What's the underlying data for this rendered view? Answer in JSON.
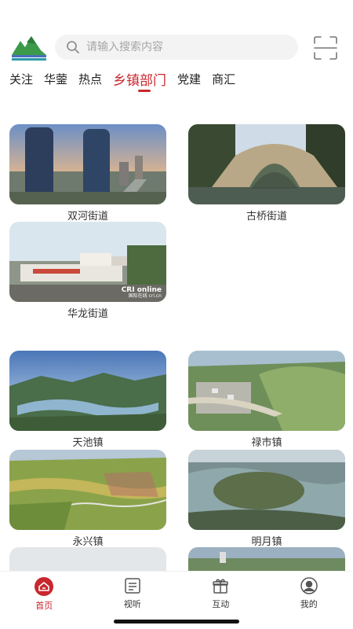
{
  "header": {
    "search_placeholder": "请输入搜索内容"
  },
  "tabs": [
    {
      "label": "关注"
    },
    {
      "label": "华蓥"
    },
    {
      "label": "热点"
    },
    {
      "label": "乡镇部门"
    },
    {
      "label": "党建"
    },
    {
      "label": "商汇"
    }
  ],
  "active_tab": "乡镇部门",
  "cards": [
    {
      "caption": "双河街道"
    },
    {
      "caption": "古桥街道"
    },
    {
      "caption": "华龙街道"
    },
    {
      "caption": "天池镇"
    },
    {
      "caption": "禄市镇"
    },
    {
      "caption": "永兴镇"
    },
    {
      "caption": "明月镇"
    }
  ],
  "watermark": {
    "brand": "CRI online",
    "sub": "国际在线 cri.cn"
  },
  "tabbar": [
    {
      "label": "首页",
      "icon": "home-icon"
    },
    {
      "label": "视听",
      "icon": "news-icon"
    },
    {
      "label": "互动",
      "icon": "gift-icon"
    },
    {
      "label": "我的",
      "icon": "user-icon"
    }
  ],
  "colors": {
    "accent": "#c9272e"
  }
}
